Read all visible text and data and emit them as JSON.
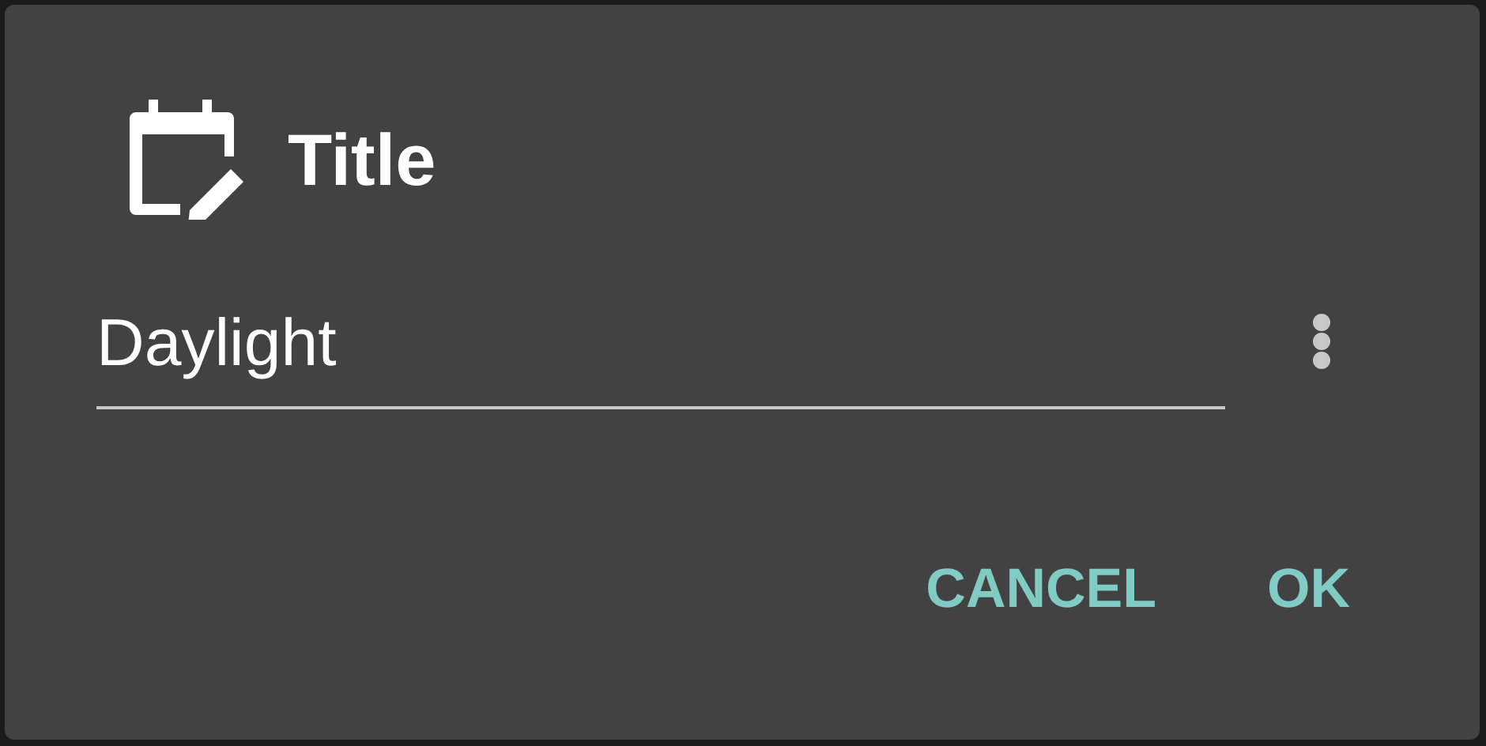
{
  "dialog": {
    "title": "Title",
    "field": {
      "value": "Daylight"
    },
    "buttons": [
      "CANCEL",
      "OK"
    ]
  }
}
